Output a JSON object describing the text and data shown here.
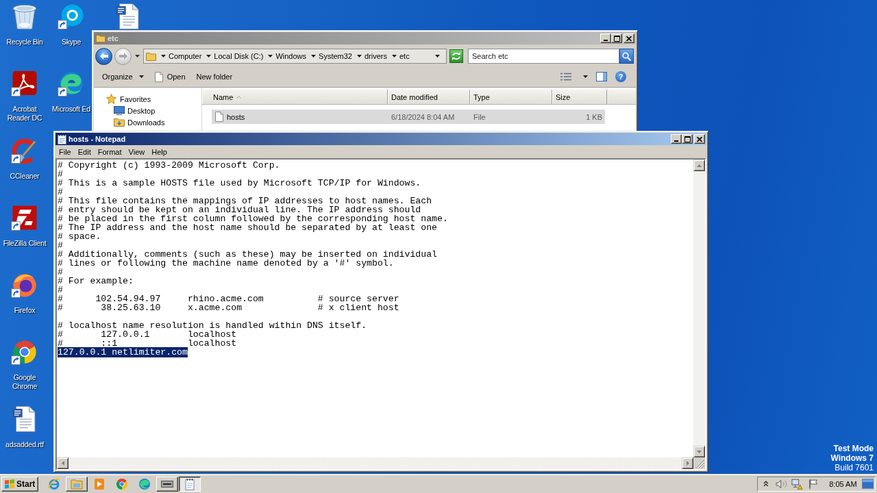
{
  "desktop": {
    "columns": [
      [
        {
          "kind": "bin",
          "label": "Recycle Bin",
          "shortcut": false
        },
        {
          "kind": "pdf",
          "label": "Acrobat Reader DC",
          "shortcut": true
        },
        {
          "kind": "cleaner",
          "label": "CCleaner",
          "shortcut": true
        },
        {
          "kind": "ftp",
          "label": "FileZilla Client",
          "shortcut": true
        },
        {
          "kind": "fox",
          "label": "Firefox",
          "shortcut": true
        },
        {
          "kind": "chrome",
          "label": "Google Chrome",
          "shortcut": true
        },
        {
          "kind": "doc",
          "label": "adsadded.rtf",
          "shortcut": false
        }
      ],
      [
        {
          "kind": "skype",
          "label": "Skype",
          "shortcut": true
        },
        {
          "kind": "edge",
          "label": "Microsoft Ed",
          "shortcut": true
        }
      ],
      [
        {
          "kind": "doc",
          "shortcut": false
        }
      ]
    ],
    "notice": {
      "lines": [
        "Test Mode",
        "Windows 7"
      ],
      "build": "Build 7601"
    }
  },
  "explorer": {
    "title": "etc",
    "active": false,
    "history": [
      {
        "kind": "back",
        "disabled": false
      },
      {
        "kind": "forward",
        "disabled": true
      }
    ],
    "breadcrumb": [
      "Computer",
      "Local Disk (C:)",
      "Windows",
      "System32",
      "drivers",
      "etc"
    ],
    "search": {
      "placeholder": "Search etc"
    },
    "toolbar": [
      {
        "kind": "menu",
        "label": "Organize"
      },
      {
        "kind": "file",
        "label": "Open"
      },
      {
        "kind": "plain",
        "label": "New folder"
      }
    ],
    "help": "?",
    "nav": [
      {
        "kind": "star",
        "label": "Favorites",
        "children": [
          {
            "kind": "desktop",
            "label": "Desktop"
          },
          {
            "kind": "folder",
            "label": "Downloads"
          }
        ]
      }
    ],
    "columns": [
      {
        "label": "Name",
        "sorted": true
      },
      {
        "label": "Date modified",
        "sorted": false
      },
      {
        "label": "Type",
        "sorted": false
      },
      {
        "label": "Size",
        "sorted": false
      }
    ],
    "rows": [
      {
        "cells": [
          "hosts",
          "6/18/2024 8:04 AM",
          "File",
          "1 KB"
        ],
        "selected": true
      }
    ]
  },
  "notepad": {
    "title": "hosts - Notepad",
    "active": true,
    "menu": [
      "File",
      "Edit",
      "Format",
      "View",
      "Help"
    ],
    "scrollbar": {
      "disabled": true
    },
    "blocks": [
      {
        "lines": [
          {
            "text": "# Copyright (c) 1993-2009 Microsoft Corp.",
            "selected": false
          },
          {
            "text": "#",
            "selected": false
          },
          {
            "text": "# This is a sample HOSTS file used by Microsoft TCP/IP for Windows.",
            "selected": false
          },
          {
            "text": "#",
            "selected": false
          },
          {
            "text": "# This file contains the mappings of IP addresses to host names. Each",
            "selected": false
          },
          {
            "text": "# entry should be kept on an individual line. The IP address should",
            "selected": false
          },
          {
            "text": "# be placed in the first column followed by the corresponding host name.",
            "selected": false
          },
          {
            "text": "# The IP address and the host name should be separated by at least one",
            "selected": false
          },
          {
            "text": "# space.",
            "selected": false
          },
          {
            "text": "#",
            "selected": false
          },
          {
            "text": "# Additionally, comments (such as these) may be inserted on individual",
            "selected": false
          },
          {
            "text": "# lines or following the machine name denoted by a '#' symbol.",
            "selected": false
          },
          {
            "text": "#",
            "selected": false
          },
          {
            "text": "# For example:",
            "selected": false
          },
          {
            "text": "#",
            "selected": false
          },
          {
            "text": "#      102.54.94.97     rhino.acme.com          # source server",
            "selected": false
          },
          {
            "text": "#       38.25.63.10     x.acme.com              # x client host",
            "selected": false
          }
        ]
      },
      {
        "lines": [
          {
            "text": "# localhost name resolution is handled within DNS itself.",
            "selected": false
          },
          {
            "text": "#       127.0.0.1       localhost",
            "selected": false
          },
          {
            "text": "#       ::1             localhost",
            "selected": false
          },
          {
            "text": "127.0.0.1 netlimiter.com",
            "selected": true
          }
        ]
      }
    ]
  },
  "taskbar": {
    "start": "Start",
    "items": [
      {
        "kind": "ie",
        "open": false,
        "selected": false
      },
      {
        "kind": "folder",
        "open": true,
        "selected": false
      },
      {
        "kind": "player",
        "open": false,
        "selected": false
      },
      {
        "kind": "chrome",
        "open": false,
        "selected": false
      },
      {
        "kind": "edge",
        "open": false,
        "selected": false
      },
      {
        "kind": "device",
        "open": true,
        "selected": false
      },
      {
        "kind": "notepad",
        "open": true,
        "selected": true
      }
    ],
    "clock": "8:05 AM"
  }
}
